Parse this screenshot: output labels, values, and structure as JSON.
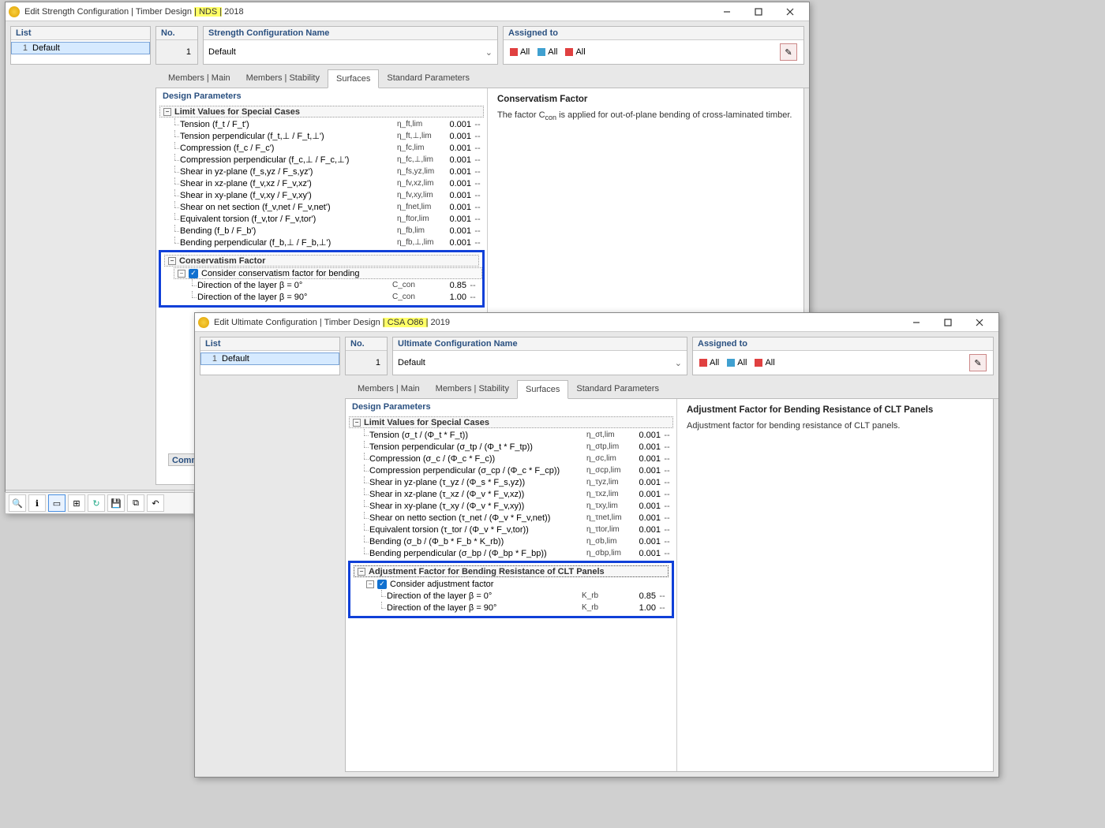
{
  "window1": {
    "title_pre": "Edit Strength Configuration | Timber Design ",
    "title_hl": "| NDS |",
    "title_post": " 2018",
    "list_header": "List",
    "list_item_idx": "1",
    "list_item_name": "Default",
    "no_header": "No.",
    "no_value": "1",
    "cfg_header": "Strength Configuration Name",
    "cfg_value": "Default",
    "assigned_header": "Assigned to",
    "assigned_all": "All",
    "tabs": {
      "members_main": "Members | Main",
      "members_stab": "Members | Stability",
      "surfaces": "Surfaces",
      "std": "Standard Parameters"
    },
    "dp_header": "Design Parameters",
    "group_limit": "Limit Values for Special Cases",
    "rows": [
      {
        "label": "Tension (f_t / F_t')",
        "sym": "η_ft,lim",
        "val": "0.001",
        "unit": "--"
      },
      {
        "label": "Tension perpendicular (f_t,⊥ / F_t,⊥')",
        "sym": "η_ft,⊥,lim",
        "val": "0.001",
        "unit": "--"
      },
      {
        "label": "Compression (f_c / F_c')",
        "sym": "η_fc,lim",
        "val": "0.001",
        "unit": "--"
      },
      {
        "label": "Compression perpendicular (f_c,⊥ / F_c,⊥')",
        "sym": "η_fc,⊥,lim",
        "val": "0.001",
        "unit": "--"
      },
      {
        "label": "Shear in yz-plane (f_s,yz / F_s,yz')",
        "sym": "η_fs,yz,lim",
        "val": "0.001",
        "unit": "--"
      },
      {
        "label": "Shear in xz-plane (f_v,xz / F_v,xz')",
        "sym": "η_fv,xz,lim",
        "val": "0.001",
        "unit": "--"
      },
      {
        "label": "Shear in xy-plane (f_v,xy / F_v,xy')",
        "sym": "η_fv,xy,lim",
        "val": "0.001",
        "unit": "--"
      },
      {
        "label": "Shear on net section (f_v,net / F_v,net')",
        "sym": "η_fnet,lim",
        "val": "0.001",
        "unit": "--"
      },
      {
        "label": "Equivalent torsion (f_v,tor / F_v,tor')",
        "sym": "η_ftor,lim",
        "val": "0.001",
        "unit": "--"
      },
      {
        "label": "Bending (f_b / F_b')",
        "sym": "η_fb,lim",
        "val": "0.001",
        "unit": "--"
      },
      {
        "label": "Bending perpendicular (f_b,⊥ / F_b,⊥')",
        "sym": "η_fb,⊥,lim",
        "val": "0.001",
        "unit": "--"
      }
    ],
    "group_cons": "Conservatism Factor",
    "check_label": "Consider conservatism factor for bending",
    "cons_rows": [
      {
        "label": "Direction of the layer β = 0°",
        "sym": "C_con",
        "val": "0.85",
        "unit": "--"
      },
      {
        "label": "Direction of the layer β = 90°",
        "sym": "C_con",
        "val": "1.00",
        "unit": "--"
      }
    ],
    "desc_title": "Conservatism Factor",
    "desc_text_pre": "The factor C",
    "desc_text_sub": "con",
    "desc_text_post": " is applied for out-of-plane bending of cross-laminated timber.",
    "comm": "Comm"
  },
  "window2": {
    "title_pre": "Edit Ultimate Configuration | Timber Design ",
    "title_hl": "| CSA O86 |",
    "title_post": " 2019",
    "list_header": "List",
    "list_item_idx": "1",
    "list_item_name": "Default",
    "no_header": "No.",
    "no_value": "1",
    "cfg_header": "Ultimate Configuration Name",
    "cfg_value": "Default",
    "assigned_header": "Assigned to",
    "assigned_all": "All",
    "tabs": {
      "members_main": "Members | Main",
      "members_stab": "Members | Stability",
      "surfaces": "Surfaces",
      "std": "Standard Parameters"
    },
    "dp_header": "Design Parameters",
    "group_limit": "Limit Values for Special Cases",
    "rows": [
      {
        "label": "Tension (σ_t / (Φ_t * F_t))",
        "sym": "η_σt,lim",
        "val": "0.001",
        "unit": "--"
      },
      {
        "label": "Tension perpendicular (σ_tp / (Φ_t * F_tp))",
        "sym": "η_σtp,lim",
        "val": "0.001",
        "unit": "--"
      },
      {
        "label": "Compression (σ_c / (Φ_c * F_c))",
        "sym": "η_σc,lim",
        "val": "0.001",
        "unit": "--"
      },
      {
        "label": "Compression perpendicular (σ_cp / (Φ_c * F_cp))",
        "sym": "η_σcp,lim",
        "val": "0.001",
        "unit": "--"
      },
      {
        "label": "Shear in yz-plane (τ_yz / (Φ_s * F_s,yz))",
        "sym": "η_τyz,lim",
        "val": "0.001",
        "unit": "--"
      },
      {
        "label": "Shear in xz-plane (τ_xz / (Φ_v * F_v,xz))",
        "sym": "η_τxz,lim",
        "val": "0.001",
        "unit": "--"
      },
      {
        "label": "Shear in xy-plane (τ_xy / (Φ_v * F_v,xy))",
        "sym": "η_τxy,lim",
        "val": "0.001",
        "unit": "--"
      },
      {
        "label": "Shear on netto section (τ_net / (Φ_v * F_v,net))",
        "sym": "η_τnet,lim",
        "val": "0.001",
        "unit": "--"
      },
      {
        "label": "Equivalent torsion (τ_tor / (Φ_v * F_v,tor))",
        "sym": "η_τtor,lim",
        "val": "0.001",
        "unit": "--"
      },
      {
        "label": "Bending (σ_b / (Φ_b * F_b * K_rb))",
        "sym": "η_σb,lim",
        "val": "0.001",
        "unit": "--"
      },
      {
        "label": "Bending perpendicular (σ_bp / (Φ_bp * F_bp))",
        "sym": "η_σbp,lim",
        "val": "0.001",
        "unit": "--"
      }
    ],
    "group_adj": "Adjustment Factor for Bending Resistance of CLT Panels",
    "check_label": "Consider adjustment factor",
    "adj_rows": [
      {
        "label": "Direction of the layer β = 0°",
        "sym": "K_rb",
        "val": "0.85",
        "unit": "--"
      },
      {
        "label": "Direction of the layer β = 90°",
        "sym": "K_rb",
        "val": "1.00",
        "unit": "--"
      }
    ],
    "desc_title": "Adjustment Factor for Bending Resistance of CLT Panels",
    "desc_text": "Adjustment factor for bending resistance of CLT panels."
  }
}
